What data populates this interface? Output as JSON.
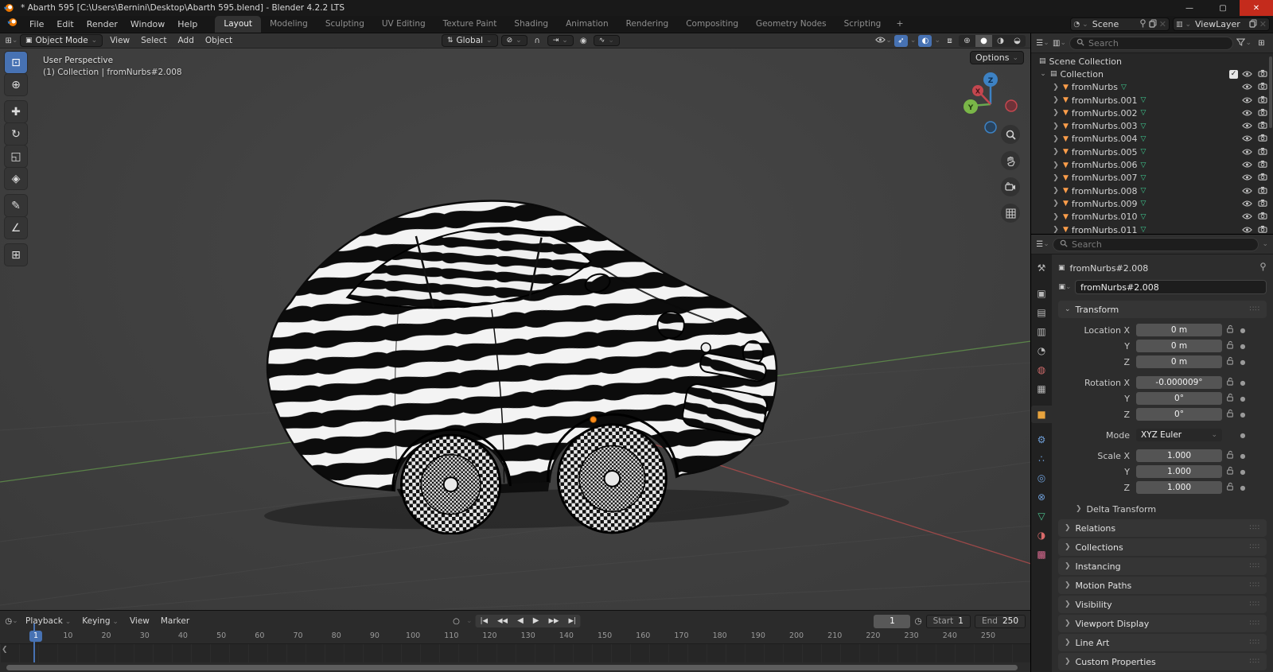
{
  "window": {
    "title": "* Abarth 595 [C:\\Users\\Bernini\\Desktop\\Abarth 595.blend] - Blender 4.2.2 LTS",
    "controls": {
      "minimize": "—",
      "maximize": "▢",
      "close": "✕"
    }
  },
  "topbar": {
    "menus": [
      "File",
      "Edit",
      "Render",
      "Window",
      "Help"
    ],
    "workspaces": [
      "Layout",
      "Modeling",
      "Sculpting",
      "UV Editing",
      "Texture Paint",
      "Shading",
      "Animation",
      "Rendering",
      "Compositing",
      "Geometry Nodes",
      "Scripting"
    ],
    "active_workspace": "Layout",
    "add_workspace": "+",
    "scene_name": "Scene",
    "view_layer_name": "ViewLayer"
  },
  "viewport": {
    "mode": "Object Mode",
    "menus": [
      "View",
      "Select",
      "Add",
      "Object"
    ],
    "orientation": "Global",
    "options_label": "Options",
    "overlay_line1": "User Perspective",
    "overlay_line2": "(1) Collection | fromNurbs#2.008",
    "tools": [
      "select-box",
      "cursor",
      "move",
      "rotate",
      "scale",
      "transform",
      "annotate",
      "measure",
      "add-cube"
    ],
    "active_tool": "select-box",
    "gizmo_axes": [
      "X",
      "Y",
      "Z"
    ],
    "nav_buttons": [
      "zoom",
      "pan",
      "camera",
      "ortho"
    ]
  },
  "outliner": {
    "search_placeholder": "Search",
    "scene_collection": "Scene Collection",
    "collection": "Collection",
    "items": [
      "fromNurbs",
      "fromNurbs.001",
      "fromNurbs.002",
      "fromNurbs.003",
      "fromNurbs.004",
      "fromNurbs.005",
      "fromNurbs.006",
      "fromNurbs.007",
      "fromNurbs.008",
      "fromNurbs.009",
      "fromNurbs.010",
      "fromNurbs.011"
    ]
  },
  "properties": {
    "search_placeholder": "Search",
    "breadcrumb": "fromNurbs#2.008",
    "name_value": "fromNurbs#2.008",
    "tabs": [
      "tool",
      "render",
      "output",
      "view-layer",
      "scene",
      "world",
      "collection",
      "object",
      "modifiers",
      "particles",
      "physics",
      "constraints",
      "data",
      "material",
      "texture"
    ],
    "active_tab": "object",
    "transform_title": "Transform",
    "transform_rows": [
      {
        "label": "Location X",
        "value": "0 m",
        "lock": true
      },
      {
        "label": "Y",
        "value": "0 m",
        "lock": true
      },
      {
        "label": "Z",
        "value": "0 m",
        "lock": true
      },
      {
        "label": "Rotation X",
        "value": "-0.000009°",
        "lock": true,
        "gap": true
      },
      {
        "label": "Y",
        "value": "0°",
        "lock": true
      },
      {
        "label": "Z",
        "value": "0°",
        "lock": true
      },
      {
        "label": "Mode",
        "value": "XYZ Euler",
        "dropdown": true,
        "gap": true
      },
      {
        "label": "Scale X",
        "value": "1.000",
        "lock": true,
        "gap": true
      },
      {
        "label": "Y",
        "value": "1.000",
        "lock": true
      },
      {
        "label": "Z",
        "value": "1.000",
        "lock": true
      }
    ],
    "subpanel": "Delta Transform",
    "panels": [
      "Relations",
      "Collections",
      "Instancing",
      "Motion Paths",
      "Visibility",
      "Viewport Display",
      "Line Art",
      "Custom Properties"
    ]
  },
  "timeline": {
    "menus": [
      {
        "label": "Playback",
        "dropdown": true
      },
      {
        "label": "Keying",
        "dropdown": true
      },
      {
        "label": "View",
        "dropdown": false
      },
      {
        "label": "Marker",
        "dropdown": false
      }
    ],
    "transport": [
      "jump-start",
      "prev-keyframe",
      "play-reverse",
      "play",
      "next-keyframe",
      "jump-end"
    ],
    "current_frame": "1",
    "start_label": "Start",
    "start_value": "1",
    "end_label": "End",
    "end_value": "250",
    "frame_start": 1,
    "frame_end": 250,
    "tick_step": 10
  },
  "colors": {
    "accent_blue": "#4772b3",
    "object_orange": "#ffa94d",
    "data_green": "#3fc98f",
    "logo_orange": "#ea7600",
    "close_red": "#c42b1c",
    "axis_x_red": "#b24c4c",
    "axis_y_green": "#6aa84f",
    "axis_z_blue": "#3d82c4"
  }
}
